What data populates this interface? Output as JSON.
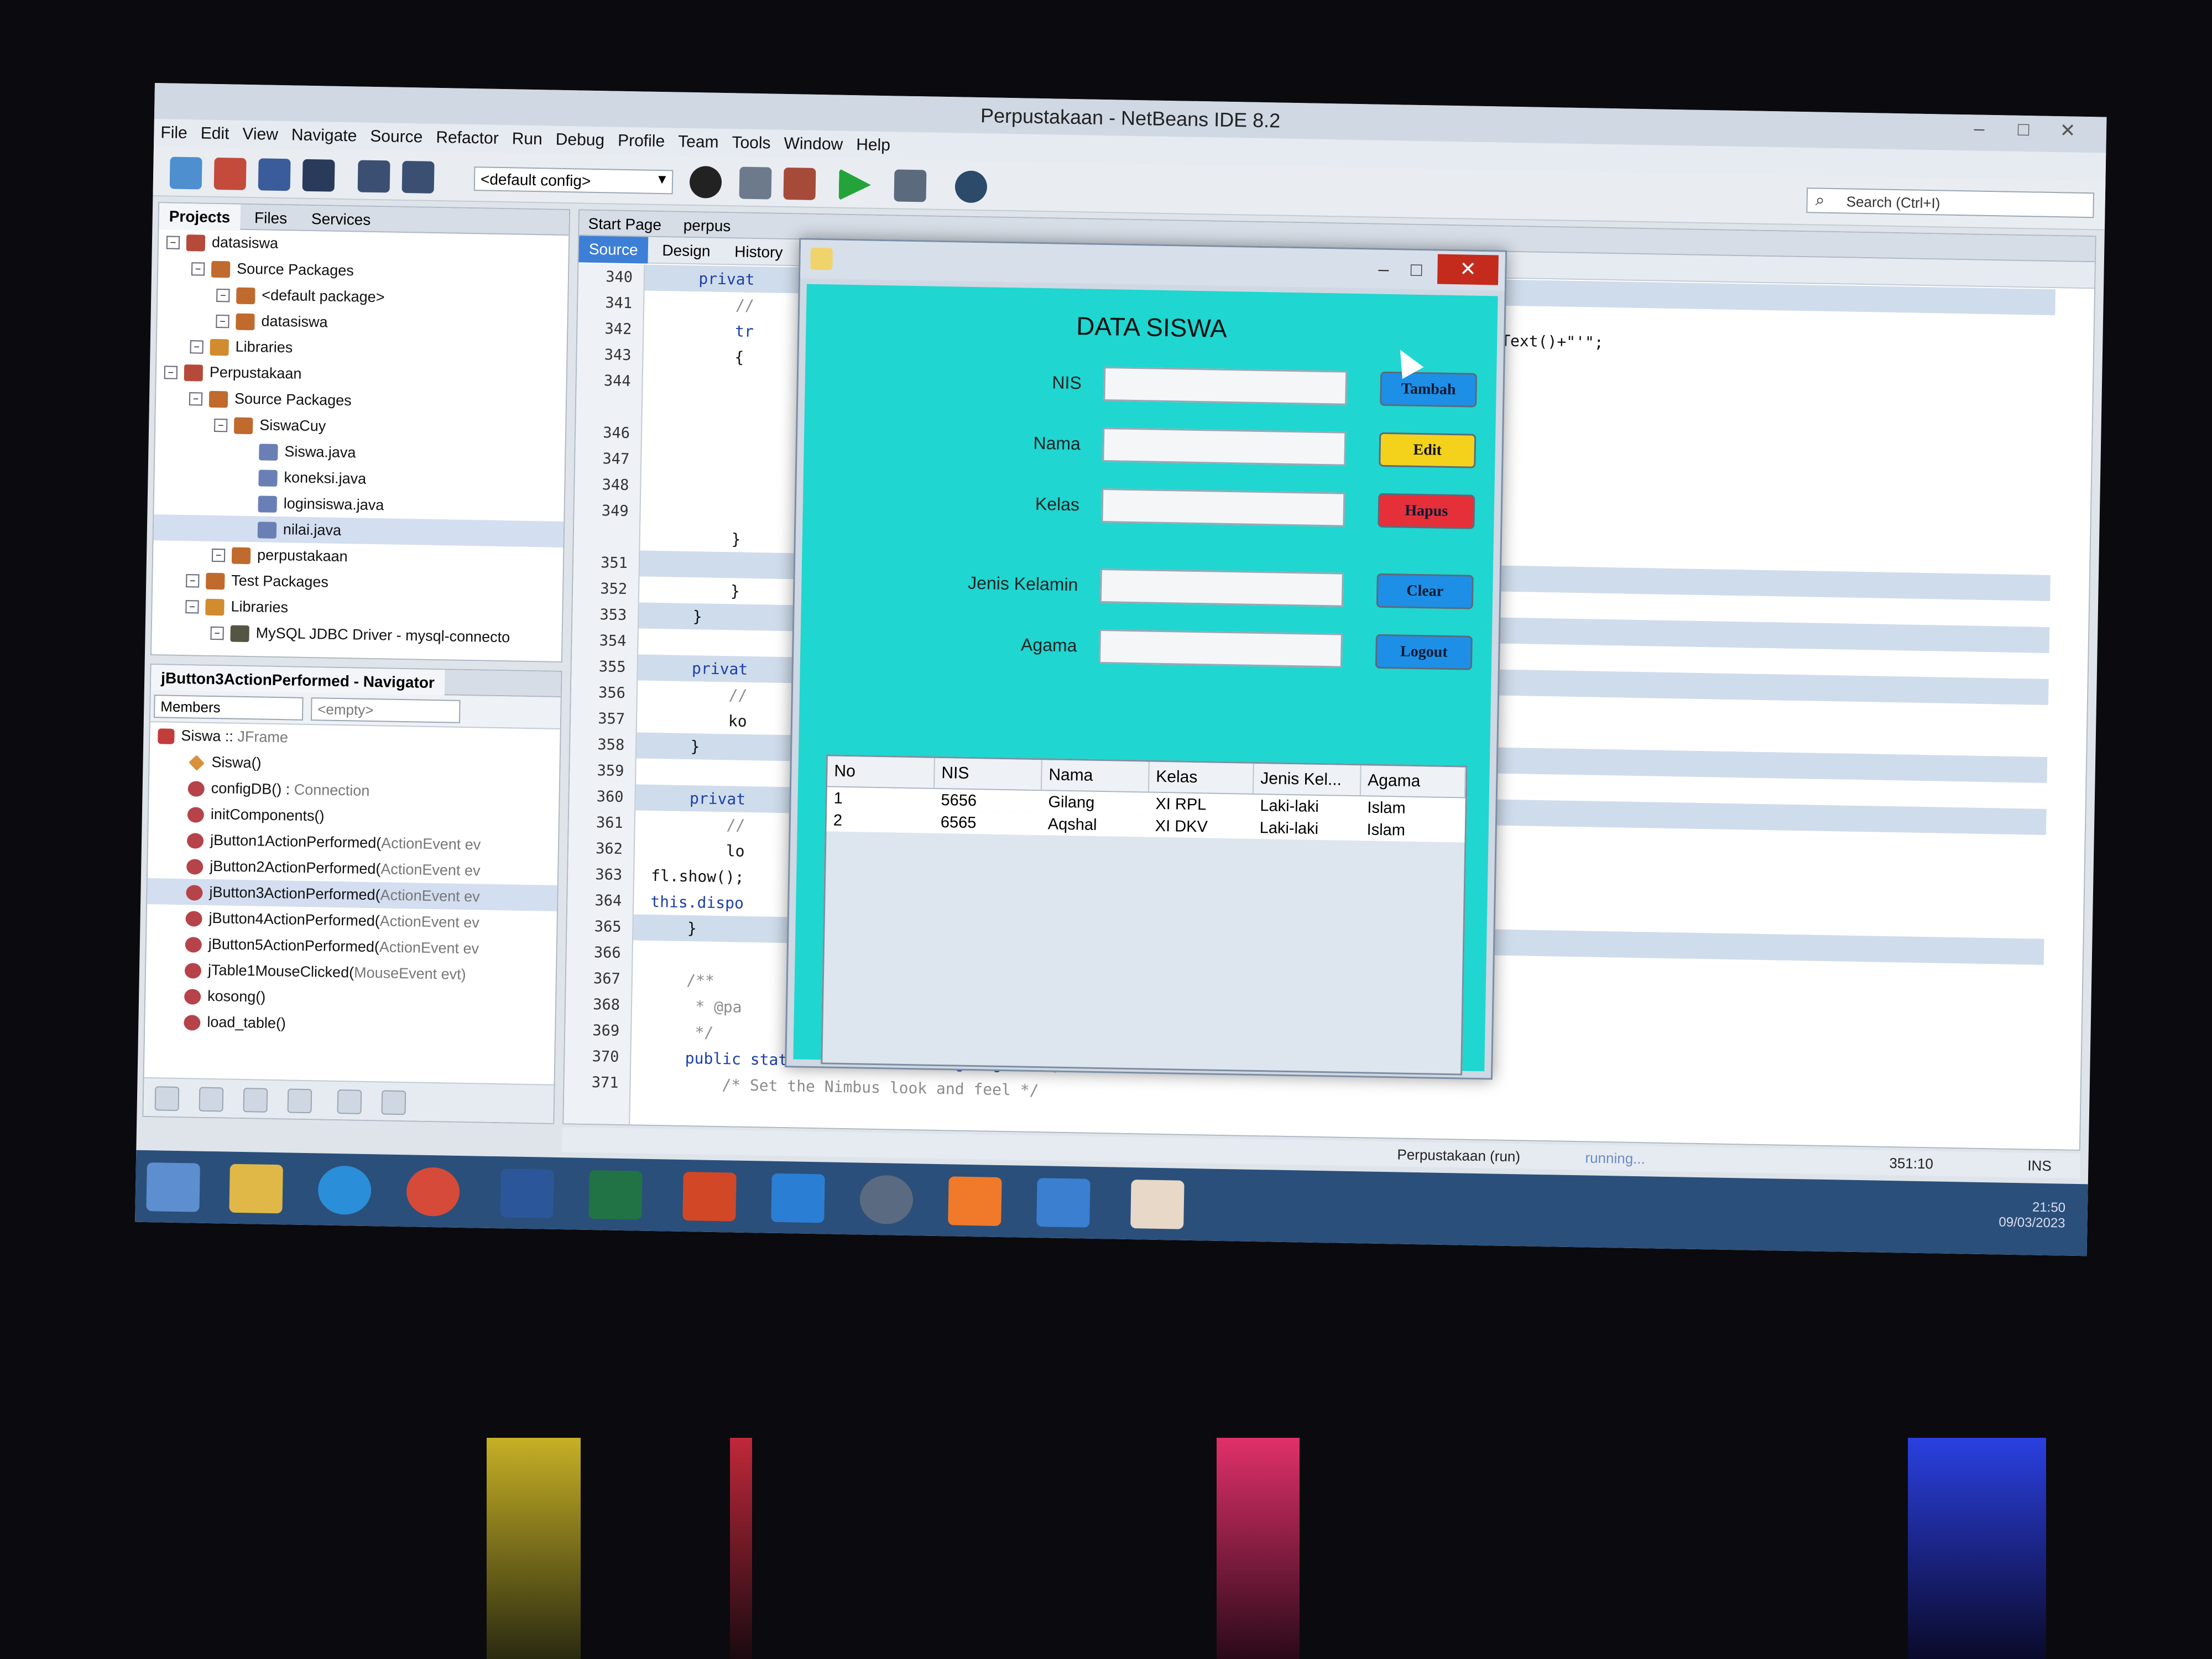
{
  "window": {
    "title": "Perpustakaan - NetBeans IDE 8.2",
    "controls": [
      "–",
      "□",
      "✕"
    ]
  },
  "menu": [
    "File",
    "Edit",
    "View",
    "Navigate",
    "Source",
    "Refactor",
    "Run",
    "Debug",
    "Profile",
    "Team",
    "Tools",
    "Window",
    "Help"
  ],
  "toolbar": {
    "config": "<default config>",
    "search_placeholder": "Search (Ctrl+I)"
  },
  "projects_panel": {
    "tabs": [
      "Projects",
      "Files",
      "Services"
    ],
    "tree": [
      {
        "label": "datasiswa",
        "level": 0,
        "icon": "cup"
      },
      {
        "label": "Source Packages",
        "level": 1,
        "icon": "pkg"
      },
      {
        "label": "<default package>",
        "level": 2,
        "icon": "pkg"
      },
      {
        "label": "datasiswa",
        "level": 2,
        "icon": "pkg"
      },
      {
        "label": "Libraries",
        "level": 1,
        "icon": "lib"
      },
      {
        "label": "Perpustakaan",
        "level": 0,
        "icon": "cup"
      },
      {
        "label": "Source Packages",
        "level": 1,
        "icon": "pkg"
      },
      {
        "label": "SiswaCuy",
        "level": 2,
        "icon": "pkg"
      },
      {
        "label": "Siswa.java",
        "level": 3,
        "icon": "java"
      },
      {
        "label": "koneksi.java",
        "level": 3,
        "icon": "java"
      },
      {
        "label": "loginsiswa.java",
        "level": 3,
        "icon": "java"
      },
      {
        "label": "nilai.java",
        "level": 3,
        "icon": "java",
        "selected": true
      },
      {
        "label": "perpustakaan",
        "level": 2,
        "icon": "pkg"
      },
      {
        "label": "Test Packages",
        "level": 1,
        "icon": "pkg"
      },
      {
        "label": "Libraries",
        "level": 1,
        "icon": "lib"
      },
      {
        "label": "MySQL JDBC Driver - mysql-connecto",
        "level": 2,
        "icon": "jar"
      }
    ]
  },
  "navigator": {
    "title": "jButton3ActionPerformed - Navigator",
    "filter": "Members",
    "filter2": "<empty>",
    "items": [
      {
        "name": "Siswa :: ",
        "type": "JFrame",
        "kind": "cls"
      },
      {
        "name": "Siswa()",
        "type": "",
        "kind": "ctor"
      },
      {
        "name": "configDB() : ",
        "type": "Connection",
        "kind": "m"
      },
      {
        "name": "initComponents()",
        "type": "",
        "kind": "m"
      },
      {
        "name": "jButton1ActionPerformed(",
        "type": "ActionEvent ev",
        "kind": "m"
      },
      {
        "name": "jButton2ActionPerformed(",
        "type": "ActionEvent ev",
        "kind": "m"
      },
      {
        "name": "jButton3ActionPerformed(",
        "type": "ActionEvent ev",
        "kind": "m",
        "selected": true
      },
      {
        "name": "jButton4ActionPerformed(",
        "type": "ActionEvent ev",
        "kind": "m"
      },
      {
        "name": "jButton5ActionPerformed(",
        "type": "ActionEvent ev",
        "kind": "m"
      },
      {
        "name": "jTable1MouseClicked(",
        "type": "MouseEvent evt)",
        "kind": "m"
      },
      {
        "name": "kosong()",
        "type": "",
        "kind": "m"
      },
      {
        "name": "load_table()",
        "type": "",
        "kind": "m"
      }
    ]
  },
  "editor": {
    "tabs": [
      "Start Page",
      "perpus"
    ],
    "subtabs": [
      "Source",
      "Design",
      "History"
    ],
    "line_numbers": [
      "340",
      "341",
      "342",
      "343",
      "344",
      "",
      "346",
      "347",
      "348",
      "349",
      "",
      "351",
      "352",
      "353",
      "354",
      "355",
      "356",
      "357",
      "358",
      "359",
      "360",
      "361",
      "362",
      "363",
      "364",
      "365",
      "366",
      "367",
      "368",
      "369",
      "370",
      "371"
    ],
    "code_lines": [
      {
        "text": "    privat",
        "cls": "kw",
        "hl": true
      },
      {
        "text": "        //",
        "cls": "cm"
      },
      {
        "text": "        tr",
        "cls": "kw"
      },
      {
        "text": "        {",
        "cls": ""
      },
      {
        "text": "",
        "cls": ""
      },
      {
        "text": "",
        "cls": ""
      },
      {
        "text": "",
        "cls": ""
      },
      {
        "text": "",
        "cls": ""
      },
      {
        "text": "",
        "cls": ""
      },
      {
        "text": "",
        "cls": ""
      },
      {
        "text": "        }",
        "cls": ""
      },
      {
        "text": "",
        "cls": "",
        "hl": true
      },
      {
        "text": "        }",
        "cls": ""
      },
      {
        "text": "    }",
        "cls": "",
        "hl": true
      },
      {
        "text": "",
        "cls": ""
      },
      {
        "text": "    privat",
        "cls": "kw",
        "hl": true
      },
      {
        "text": "        //",
        "cls": "cm"
      },
      {
        "text": "        ko",
        "cls": ""
      },
      {
        "text": "    }",
        "cls": "",
        "hl": true
      },
      {
        "text": "",
        "cls": ""
      },
      {
        "text": "    privat",
        "cls": "kw",
        "hl": true
      },
      {
        "text": "        //",
        "cls": "cm"
      },
      {
        "text": "        lo",
        "cls": ""
      },
      {
        "text": "fl.show();",
        "cls": ""
      },
      {
        "text": "this.dispo",
        "cls": "kw"
      },
      {
        "text": "    }",
        "cls": "",
        "hl": true
      },
      {
        "text": "",
        "cls": ""
      },
      {
        "text": "    /**",
        "cls": "cm"
      },
      {
        "text": "     * @pa",
        "cls": "cm"
      },
      {
        "text": "     */",
        "cls": "cm"
      },
      {
        "text": "    public static void main(String args[]) {",
        "cls": "kw"
      },
      {
        "text": "        /* Set the Nimbus look and feel */",
        "cls": "cm"
      }
    ],
    "right_fragment": "Text()+\"'\";"
  },
  "status": {
    "run": "Perpustakaan (run)",
    "progress": "running...",
    "position": "351:10",
    "mode": "INS"
  },
  "clock": {
    "time": "21:50",
    "date": "09/03/2023"
  },
  "dialog": {
    "heading": "DATA SISWA",
    "fields": [
      {
        "label": "NIS",
        "value": ""
      },
      {
        "label": "Nama",
        "value": ""
      },
      {
        "label": "Kelas",
        "value": ""
      },
      {
        "label": "Jenis Kelamin",
        "value": ""
      },
      {
        "label": "Agama",
        "value": ""
      }
    ],
    "buttons": [
      {
        "label": "Tambah",
        "color": "#1e8fe6"
      },
      {
        "label": "Edit",
        "color": "#f4d21c"
      },
      {
        "label": "Hapus",
        "color": "#e5303a"
      },
      {
        "label": "Clear",
        "color": "#1e8fe6"
      },
      {
        "label": "Logout",
        "color": "#1e8fe6"
      }
    ],
    "table": {
      "columns": [
        "No",
        "NIS",
        "Nama",
        "Kelas",
        "Jenis Kel...",
        "Agama"
      ],
      "rows": [
        [
          "1",
          "5656",
          "Gilang",
          "XI RPL",
          "Laki-laki",
          "Islam"
        ],
        [
          "2",
          "6565",
          "Aqshal",
          "XI DKV",
          "Laki-laki",
          "Islam"
        ]
      ]
    }
  },
  "colors": {
    "dialog_bg": "#1fd6d1",
    "close_red": "#c42b1c",
    "selection": "#d3def0"
  }
}
